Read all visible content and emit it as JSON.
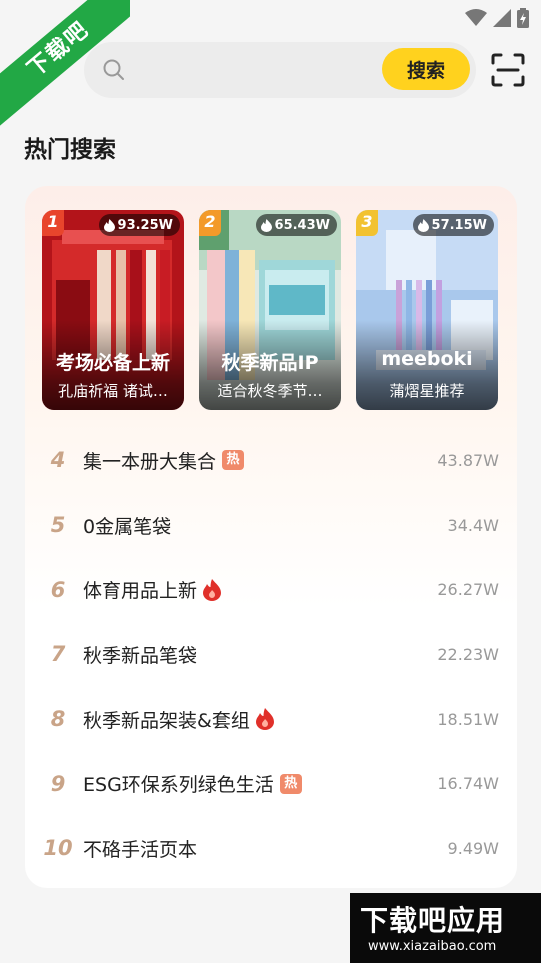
{
  "watermark": {
    "corner_text": "下载吧",
    "bottom_brand": "下载吧应用",
    "bottom_url": "www.xiazaibao.com"
  },
  "search": {
    "placeholder": "",
    "button_label": "搜索"
  },
  "section": {
    "title": "热门搜索"
  },
  "top_items": [
    {
      "rank": "1",
      "heat": "93.25W",
      "title": "考场必备上新",
      "subtitle": "孔庙祈福 诸试…",
      "rank_color": "#e8452c"
    },
    {
      "rank": "2",
      "heat": "65.43W",
      "title": "秋季新品IP",
      "subtitle": "适合秋冬季节…",
      "rank_color": "#f39a2a"
    },
    {
      "rank": "3",
      "heat": "57.15W",
      "title": "meeboki",
      "subtitle": "蒲熠星推荐",
      "rank_color": "#f2c230"
    }
  ],
  "list": [
    {
      "rank": "4",
      "label": "集一本册大集合",
      "badge": "hot",
      "badge_text": "热",
      "heat": "43.87W"
    },
    {
      "rank": "5",
      "label": "0金属笔袋",
      "badge": "",
      "heat": "34.4W"
    },
    {
      "rank": "6",
      "label": "体育用品上新",
      "badge": "fire",
      "heat": "26.27W"
    },
    {
      "rank": "7",
      "label": "秋季新品笔袋",
      "badge": "",
      "heat": "22.23W"
    },
    {
      "rank": "8",
      "label": "秋季新品架装&套组",
      "badge": "fire",
      "heat": "18.51W"
    },
    {
      "rank": "9",
      "label": "ESG环保系列绿色生活",
      "badge": "hot",
      "badge_text": "热",
      "heat": "16.74W"
    },
    {
      "rank": "10",
      "label": "不硌手活页本",
      "badge": "",
      "heat": "9.49W"
    }
  ],
  "colors": {
    "accent": "#ffd21e",
    "rank_number": "#c9a488",
    "hot_badge": "#f08a6a",
    "fire": "#e0302a"
  }
}
